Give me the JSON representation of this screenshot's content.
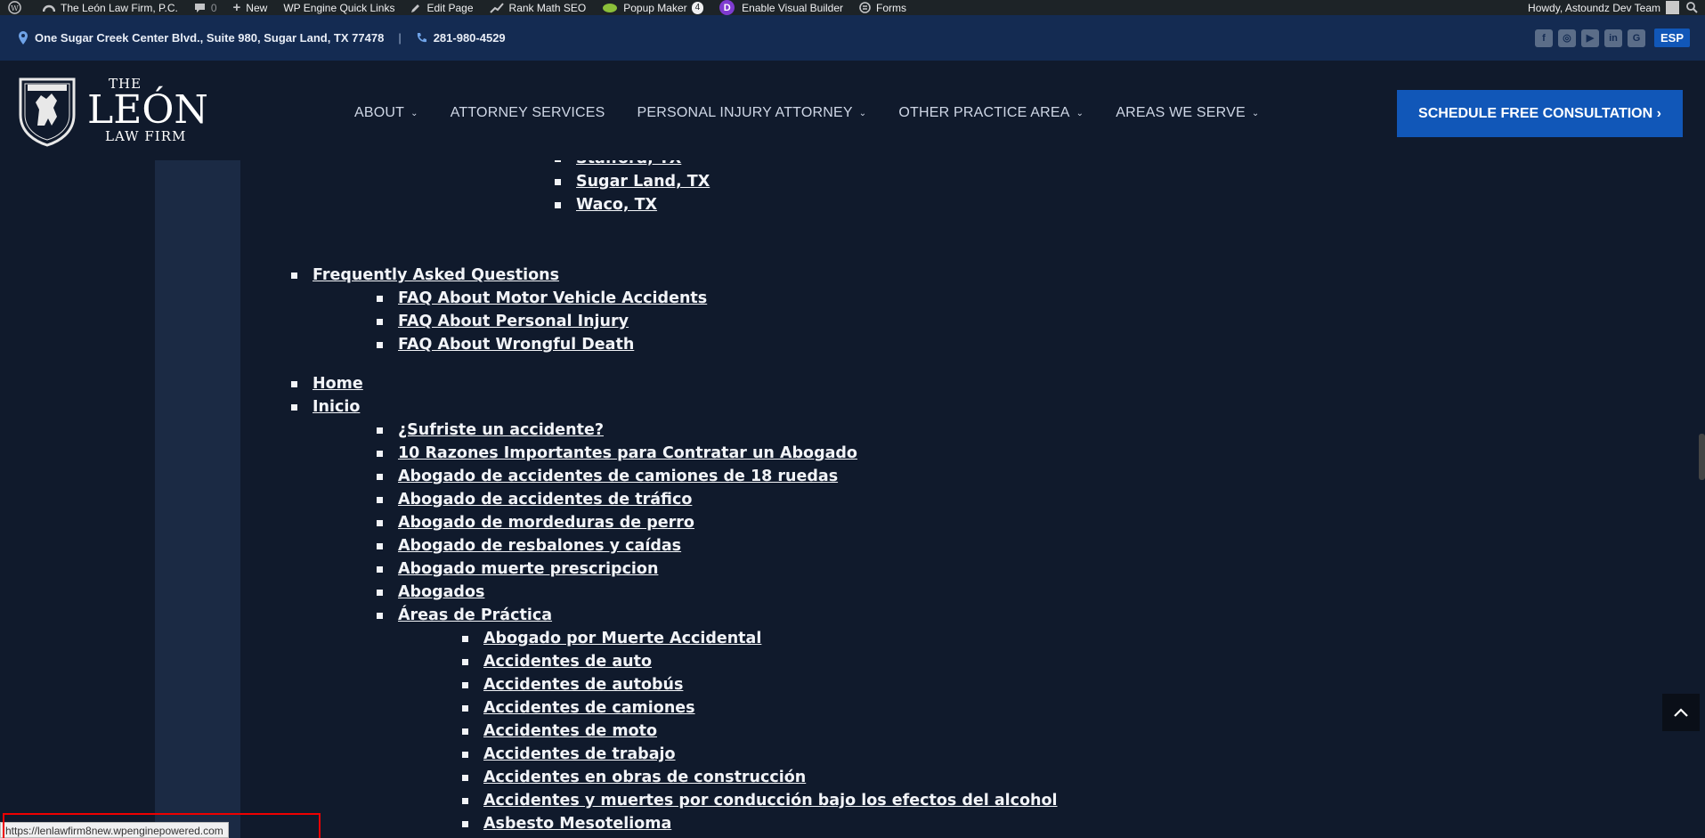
{
  "adminbar": {
    "site_name": "The León Law Firm, P.C.",
    "comments_count": "0",
    "new_label": "New",
    "wpengine_label": "WP Engine Quick Links",
    "edit_page_label": "Edit Page",
    "rankmath_label": "Rank Math SEO",
    "popup_label": "Popup Maker",
    "popup_count": "4",
    "visual_builder_label": "Enable Visual Builder",
    "forms_label": "Forms",
    "howdy": "Howdy, Astoundz Dev Team"
  },
  "infobar": {
    "address": "One Sugar Creek Center Blvd., Suite 980, Sugar Land, TX 77478",
    "separator": "|",
    "phone": "281-980-4529",
    "lang": "ESP",
    "socials": [
      "facebook-icon",
      "instagram-icon",
      "youtube-icon",
      "linkedin-icon",
      "google-icon"
    ]
  },
  "header": {
    "logo": {
      "the": "THE",
      "leon": "LEÓN",
      "law_firm": "LAW FIRM"
    },
    "nav": [
      "ABOUT",
      "ATTORNEY SERVICES",
      "PERSONAL INJURY ATTORNEY",
      "OTHER PRACTICE AREA",
      "AREAS WE SERVE"
    ],
    "cta": "SCHEDULE FREE CONSULTATION ›"
  },
  "sitemap": {
    "partial": "Stafford, TX",
    "cities": [
      "Sugar Land, TX",
      "Waco, TX"
    ],
    "faq": "Frequently Asked Questions",
    "faq_items": [
      "FAQ About Motor Vehicle Accidents",
      "FAQ About Personal Injury",
      "FAQ About Wrongful Death"
    ],
    "home": "Home",
    "inicio": "Inicio",
    "inicio_items": [
      "¿Sufriste un accidente?",
      "10 Razones Importantes para Contratar un Abogado",
      "Abogado de accidentes de camiones de 18 ruedas",
      "Abogado de accidentes de tráfico",
      "Abogado de mordeduras de perro",
      "Abogado de resbalones y caídas",
      "Abogado muerte prescripcion",
      "Abogados",
      "Áreas de Práctica"
    ],
    "areas_items": [
      "Abogado por Muerte Accidental",
      "Accidentes de auto",
      "Accidentes de autobús",
      "Accidentes de camiones",
      "Accidentes de moto",
      "Accidentes de trabajo",
      "Accidentes en obras de construcción",
      "Accidentes y muertes por conducción bajo los efectos del alcohol",
      "Asbesto Mesotelioma"
    ]
  },
  "status_bar": {
    "url": "https://lenlawfirm8new.wpenginepowered.com"
  }
}
